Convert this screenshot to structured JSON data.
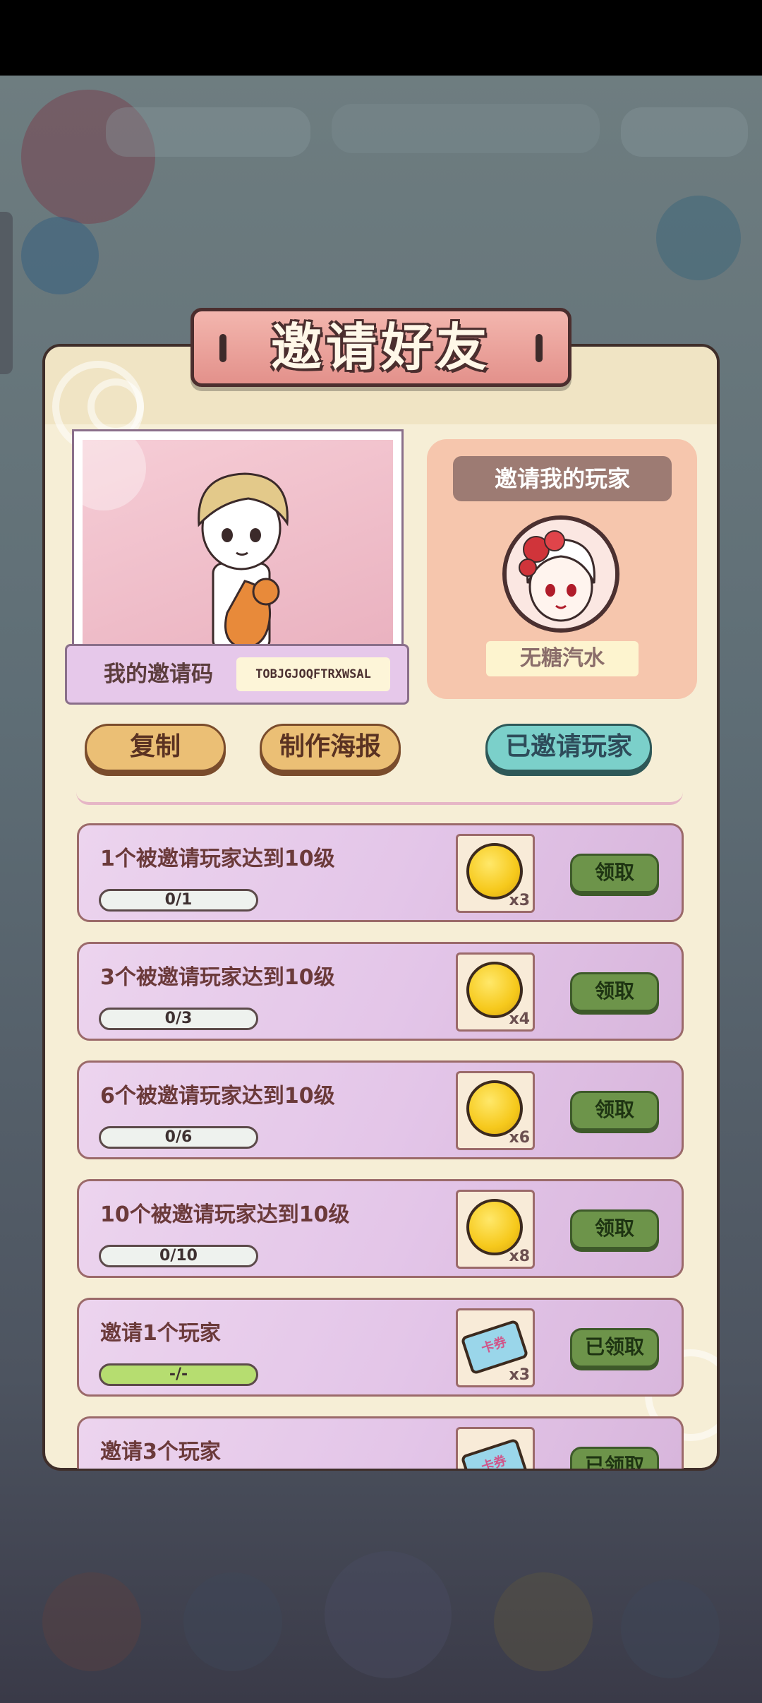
{
  "dialog": {
    "title": "邀请好友"
  },
  "invite": {
    "label": "我的邀请码",
    "code": "TOBJGJOQFTRXWSAL"
  },
  "inviter": {
    "title": "邀请我的玩家",
    "name": "无糖汽水"
  },
  "buttons": {
    "copy": "复制",
    "poster": "制作海报",
    "invited_players": "已邀请玩家"
  },
  "tasks": [
    {
      "title": "1个被邀请玩家达到10级",
      "progress": "0/1",
      "reward_icon": "gold-coin-icon",
      "qty": "x3",
      "claim": "领取",
      "claimed": false
    },
    {
      "title": "3个被邀请玩家达到10级",
      "progress": "0/3",
      "reward_icon": "gold-coin-icon",
      "qty": "x4",
      "claim": "领取",
      "claimed": false
    },
    {
      "title": "6个被邀请玩家达到10级",
      "progress": "0/6",
      "reward_icon": "gold-coin-icon",
      "qty": "x6",
      "claim": "领取",
      "claimed": false
    },
    {
      "title": "10个被邀请玩家达到10级",
      "progress": "0/10",
      "reward_icon": "gold-coin-icon",
      "qty": "x8",
      "claim": "领取",
      "claimed": false
    },
    {
      "title": "邀请1个玩家",
      "progress": "-/-",
      "reward_icon": "card-ticket-icon",
      "ticket_text": "卡券",
      "qty": "x3",
      "claim": "已领取",
      "claimed": true
    },
    {
      "title": "邀请3个玩家",
      "progress": "",
      "reward_icon": "card-ticket-icon",
      "ticket_text": "卡券",
      "qty": "",
      "claim": "已领取",
      "claimed": true
    }
  ],
  "colors": {
    "panel_bg": "#f6eed6",
    "title_plate": "#e3918b",
    "claim_button": "#6d944a",
    "teal_button": "#7bd0ca",
    "gold_button": "#ebbf75"
  }
}
